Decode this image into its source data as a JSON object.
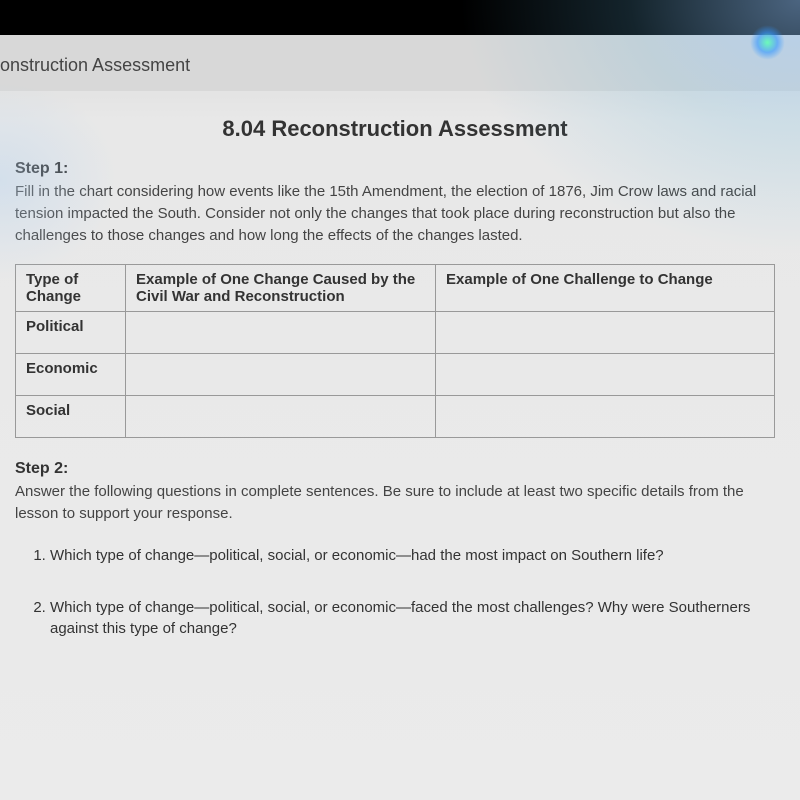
{
  "header": {
    "page_title_partial": "onstruction Assessment"
  },
  "document": {
    "title": "8.04 Reconstruction Assessment",
    "step1": {
      "heading": "Step 1:",
      "instructions": "Fill in the chart considering how events like the 15th Amendment, the election of 1876, Jim Crow laws and racial tension impacted the South. Consider not only the changes that took place during reconstruction but also the challenges to those changes and how long the effects of the changes lasted."
    },
    "table": {
      "headers": {
        "type": "Type of Change",
        "example": "Example of One Change Caused by the Civil War and Reconstruction",
        "challenge": "Example of One Challenge to Change"
      },
      "rows": [
        {
          "label": "Political",
          "example": "",
          "challenge": ""
        },
        {
          "label": "Economic",
          "example": "",
          "challenge": ""
        },
        {
          "label": "Social",
          "example": "",
          "challenge": ""
        }
      ]
    },
    "step2": {
      "heading": "Step 2:",
      "instructions": "Answer the following questions in complete sentences. Be sure to include at least two specific details from the lesson to support your response.",
      "questions": [
        "Which type of change—political, social, or economic—had the most impact on Southern life?",
        "Which type of change—political, social, or economic—faced the most challenges? Why were Southerners against this type of change?"
      ]
    }
  }
}
